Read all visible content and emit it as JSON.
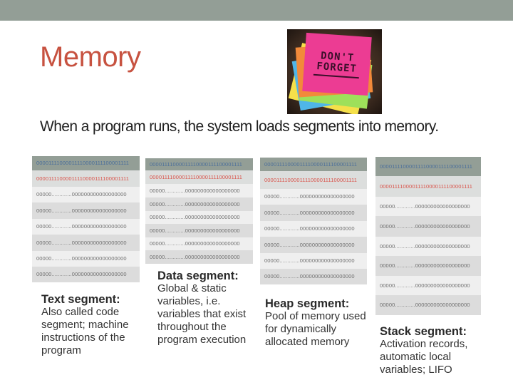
{
  "slide": {
    "title": "Memory",
    "subtitle": "When a program runs, the system loads segments into memory.",
    "image": {
      "description": "sticky-notes-photo",
      "note_text_line1": "DON'T",
      "note_text_line2": "FORGET"
    }
  },
  "colors": {
    "title": "#c75240",
    "header_bar": "#939e96",
    "header_row_text": "#4c6f9a",
    "highlight_row_text": "#d9534a"
  },
  "segments": [
    {
      "name": "text",
      "rows": {
        "header": "00001111000011110000111100001111",
        "highlight": "00001111000011110000111100001111",
        "filler": [
          "00000.............000000000000000000",
          "00000.............000000000000000000",
          "00000.............000000000000000000",
          "00000.............000000000000000000",
          "00000.............000000000000000000",
          "00000.............000000000000000000"
        ]
      },
      "caption_title": "Text segment:",
      "caption_body": [
        "Also called code",
        "segment; machine",
        "instructions of the",
        "program"
      ]
    },
    {
      "name": "data",
      "rows": {
        "header": "00001111000011110000111100001111",
        "highlight": "00001111000011110000111100001111",
        "filler": [
          "00000.............000000000000000000",
          "00000.............000000000000000000",
          "00000.............000000000000000000",
          "00000.............000000000000000000",
          "00000.............000000000000000000",
          "00000.............000000000000000000"
        ]
      },
      "caption_title": "Data segment:",
      "caption_body": [
        "Global & static",
        "variables, i.e.",
        "variables that exist",
        "throughout the",
        "program execution"
      ]
    },
    {
      "name": "heap",
      "rows": {
        "header": "00001111000011110000111100001111",
        "highlight": "00001111000011110000111100001111",
        "filler": [
          "00000.............000000000000000000",
          "00000.............000000000000000000",
          "00000.............000000000000000000",
          "00000.............000000000000000000",
          "00000.............000000000000000000",
          "00000.............000000000000000000"
        ]
      },
      "caption_title": "Heap segment:",
      "caption_body": [
        "Pool of memory used",
        "for dynamically",
        "allocated memory"
      ]
    },
    {
      "name": "stack",
      "rows": {
        "header": "00001111000011110000111100001111",
        "highlight": "00001111000011110000111100001111",
        "filler": [
          "00000.............000000000000000000",
          "00000.............000000000000000000",
          "00000.............000000000000000000",
          "00000.............000000000000000000",
          "00000.............000000000000000000",
          "00000.............000000000000000000"
        ]
      },
      "caption_title": "Stack segment:",
      "caption_body": [
        "Activation records,",
        "automatic local",
        "variables; LIFO"
      ]
    }
  ]
}
